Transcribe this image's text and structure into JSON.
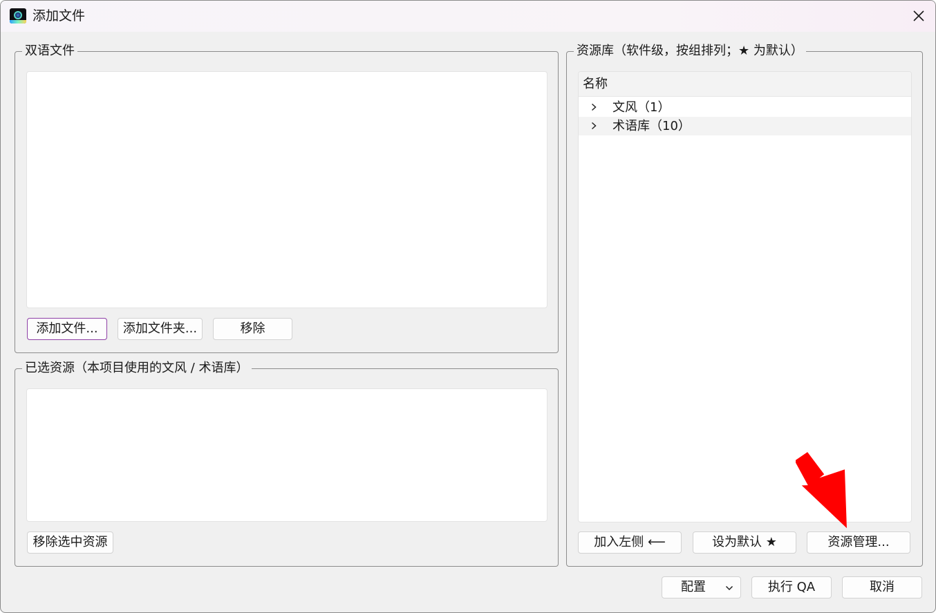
{
  "window": {
    "title": "添加文件",
    "close_icon": "close-icon",
    "app_icon": "app-lens-icon"
  },
  "bilingual": {
    "legend": "双语文件",
    "buttons": {
      "add_file": "添加文件...",
      "add_folder": "添加文件夹...",
      "remove": "移除"
    }
  },
  "selected": {
    "legend": "已选资源（本项目使用的文风 / 术语库）",
    "buttons": {
      "remove_selected": "移除选中资源"
    }
  },
  "library": {
    "legend": "资源库（软件级，按组排列；★ 为默认）",
    "column_header": "名称",
    "rows": [
      {
        "label": "文风（1）"
      },
      {
        "label": "术语库（10）"
      }
    ],
    "buttons": {
      "add_left": "加入左侧 ⟵",
      "set_default": "设为默认 ★",
      "manage": "资源管理..."
    }
  },
  "footer": {
    "config_label": "配置",
    "run_qa": "执行 QA",
    "cancel": "取消"
  },
  "colors": {
    "focus_border": "#8e3fa6",
    "annotation_arrow": "#ff0000"
  }
}
